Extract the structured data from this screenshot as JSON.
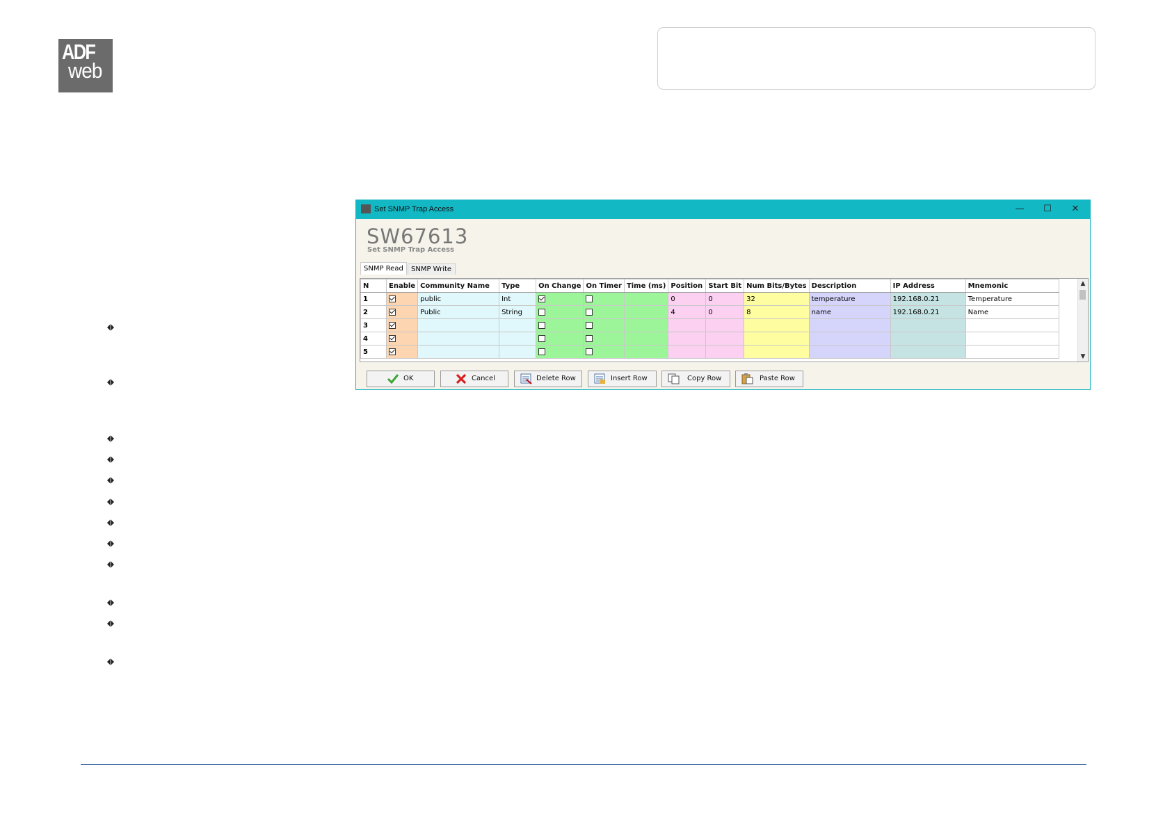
{
  "logo": {
    "line1": "ADF",
    "line2": "web"
  },
  "window": {
    "title": "Set SNMP Trap Access",
    "minimize": "—",
    "maximize": "☐",
    "close": "✕",
    "product_code": "SW67613",
    "subtitle": "Set SNMP Trap Access",
    "tabs": [
      {
        "label": "SNMP Read",
        "active": true
      },
      {
        "label": "SNMP Write",
        "active": false
      }
    ]
  },
  "grid": {
    "columns": [
      "N",
      "Enable",
      "Community Name",
      "Type",
      "On Change",
      "On Timer",
      "Time (ms)",
      "Position",
      "Start Bit",
      "Num Bits/Bytes",
      "Description",
      "IP Address",
      "Mnemonic"
    ],
    "rows": [
      {
        "n": "1",
        "enable": true,
        "community": "public",
        "type": "Int",
        "on_change": true,
        "on_timer": false,
        "time": "",
        "position": "0",
        "start_bit": "0",
        "num_bits": "32",
        "description": "temperature",
        "ip": "192.168.0.21",
        "mnemonic": "Temperature"
      },
      {
        "n": "2",
        "enable": true,
        "community": "Public",
        "type": "String",
        "on_change": false,
        "on_timer": false,
        "time": "",
        "position": "4",
        "start_bit": "0",
        "num_bits": "8",
        "description": "name",
        "ip": "192.168.0.21",
        "mnemonic": "Name"
      },
      {
        "n": "3",
        "enable": true,
        "community": "",
        "type": "",
        "on_change": false,
        "on_timer": false,
        "time": "",
        "position": "",
        "start_bit": "",
        "num_bits": "",
        "description": "",
        "ip": "",
        "mnemonic": ""
      },
      {
        "n": "4",
        "enable": true,
        "community": "",
        "type": "",
        "on_change": false,
        "on_timer": false,
        "time": "",
        "position": "",
        "start_bit": "",
        "num_bits": "",
        "description": "",
        "ip": "",
        "mnemonic": ""
      },
      {
        "n": "5",
        "enable": true,
        "community": "",
        "type": "",
        "on_change": false,
        "on_timer": false,
        "time": "",
        "position": "",
        "start_bit": "",
        "num_bits": "",
        "description": "",
        "ip": "",
        "mnemonic": ""
      }
    ]
  },
  "buttons": {
    "ok": "OK",
    "cancel": "Cancel",
    "delete_row": "Delete Row",
    "insert_row": "Insert Row",
    "copy_row": "Copy Row",
    "paste_row": "Paste Row"
  },
  "scroll": {
    "up": "▲",
    "down": "▼"
  },
  "bullet_count": 12
}
